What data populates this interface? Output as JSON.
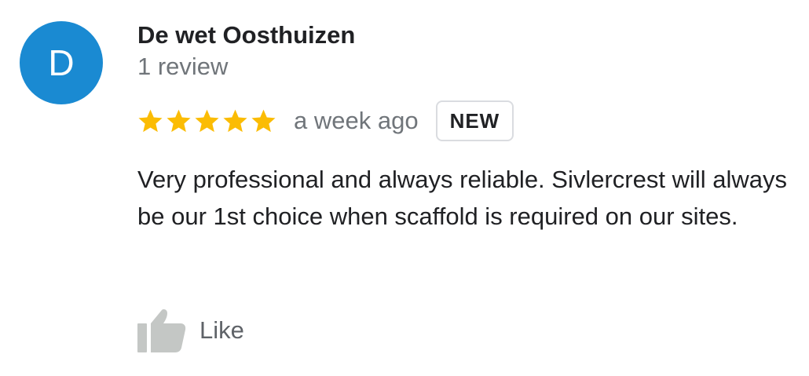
{
  "review": {
    "author": {
      "initial": "D",
      "name": "De wet Oosthuizen",
      "review_count": "1 review",
      "avatar_color": "#1a8ad2"
    },
    "rating": {
      "stars": 5,
      "max": 5,
      "star_color": "#fbbc04"
    },
    "time_ago": "a week ago",
    "badge": "NEW",
    "text": "Very professional and always reliable. Sivlercrest will always be our 1st choice when scaffold is required on our sites.",
    "actions": {
      "like_label": "Like",
      "like_icon": "thumbs-up-icon",
      "icon_color": "#c4c7c5"
    }
  }
}
